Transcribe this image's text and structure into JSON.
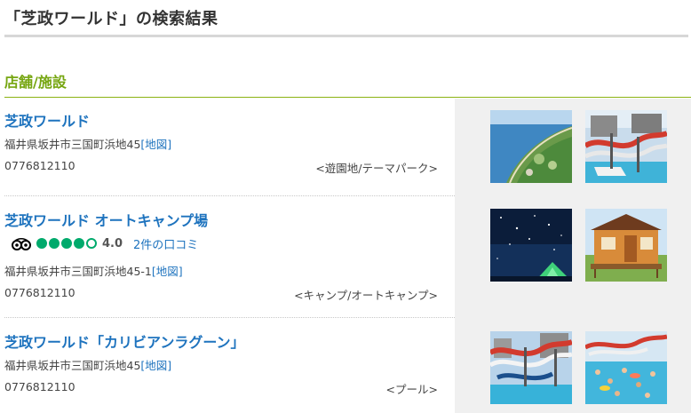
{
  "page": {
    "title": "「芝政ワールド」の検索結果"
  },
  "section": {
    "title": "店舗/施設"
  },
  "results": [
    {
      "name": "芝政ワールド",
      "address": "福井県坂井市三国町浜地45",
      "map_link": "[地図]",
      "phone": "0776812110",
      "category": "<遊園地/テーマパーク>",
      "images": [
        "aerial-coast-photo",
        "water-slide-photo"
      ]
    },
    {
      "name": "芝政ワールド オートキャンプ場",
      "rating": {
        "score": "4.0",
        "bubbles": 4,
        "max": 5,
        "reviews": "2件の口コミ"
      },
      "address": "福井県坂井市三国町浜地45-1",
      "map_link": "[地図]",
      "phone": "0776812110",
      "category": "<キャンプ/オートキャンプ>",
      "images": [
        "night-sky-tent-photo",
        "cabin-photo"
      ]
    },
    {
      "name": "芝政ワールド「カリビアンラグーン」",
      "address": "福井県坂井市三国町浜地45",
      "map_link": "[地図]",
      "phone": "0776812110",
      "category": "<プール>",
      "images": [
        "water-slide-photo",
        "wave-pool-photo"
      ]
    }
  ],
  "colors": {
    "link": "#1e73be",
    "section": "#76a611",
    "rating": "#00aa6c",
    "thumb_bg": "#f0f0f0"
  }
}
